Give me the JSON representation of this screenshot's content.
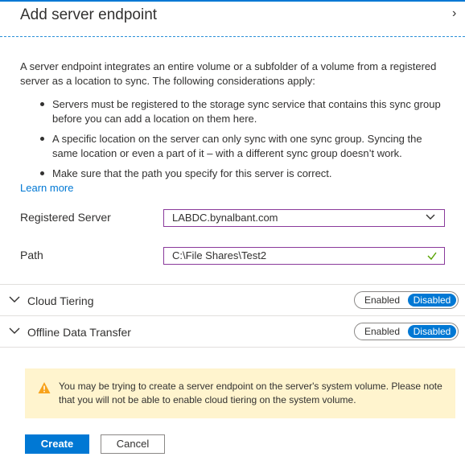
{
  "header": {
    "title": "Add server endpoint"
  },
  "intro": {
    "text": "A server endpoint integrates an entire volume or a subfolder of a volume from a registered server as a location to sync. The following considerations apply:",
    "bullets": [
      "Servers must be registered to the storage sync service that contains this sync group before you can add a location on them here.",
      "A specific location on the server can only sync with one sync group. Syncing the same location or even a part of it – with a different sync group doesn’t work.",
      "Make sure that the path you specify for this server is correct."
    ],
    "learn_more": "Learn more"
  },
  "form": {
    "registered_server_label": "Registered Server",
    "registered_server_value": "LABDC.bynalbant.com",
    "path_label": "Path",
    "path_value": "C:\\File Shares\\Test2"
  },
  "sections": [
    {
      "label": "Cloud Tiering",
      "enabled_label": "Enabled",
      "disabled_label": "Disabled",
      "selected": "Disabled"
    },
    {
      "label": "Offline Data Transfer",
      "enabled_label": "Enabled",
      "disabled_label": "Disabled",
      "selected": "Disabled"
    }
  ],
  "warning": {
    "text": "You may be trying to create a server endpoint on the server's system volume. Please note that you will not be able to enable cloud tiering on the system volume.",
    "icon": "warning-triangle-icon"
  },
  "buttons": {
    "create": "Create",
    "cancel": "Cancel"
  },
  "colors": {
    "accent": "#0078d4",
    "field_border": "#8a3a9b",
    "warning_bg": "#fff4ce",
    "warning_icon": "#f7a21b",
    "success_check": "#57a300"
  }
}
